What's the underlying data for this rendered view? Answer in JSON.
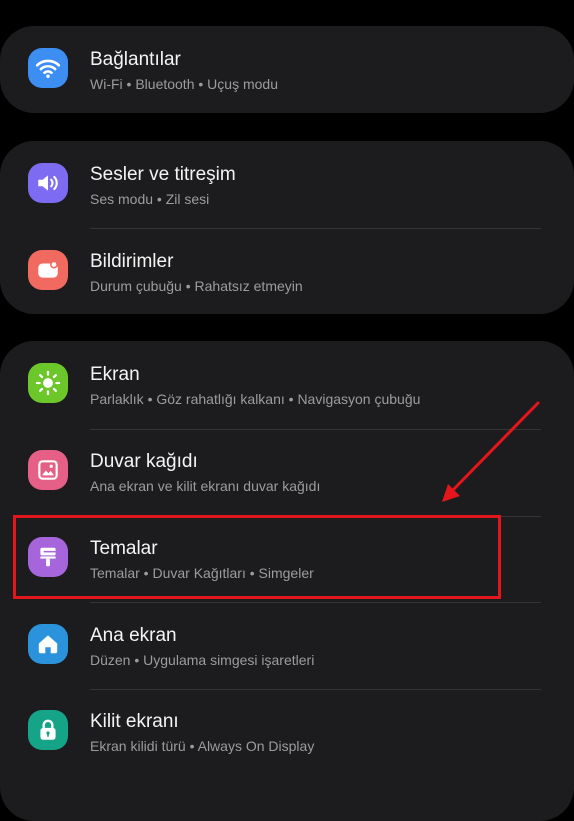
{
  "colors": {
    "background": "#000000",
    "card": "#1c1c1e",
    "highlight": "#e3161c"
  },
  "groups": [
    {
      "items": [
        {
          "title": "Bağlantılar",
          "subtitle": "Wi-Fi  •  Bluetooth  •  Uçuş modu",
          "icon": "wifi-icon",
          "icon_color": "#3d8ef3"
        }
      ]
    },
    {
      "items": [
        {
          "title": "Sesler ve titreşim",
          "subtitle": "Ses modu  •  Zil sesi",
          "icon": "sound-icon",
          "icon_color": "#7d6cf1"
        },
        {
          "title": "Bildirimler",
          "subtitle": "Durum çubuğu  •  Rahatsız etmeyin",
          "icon": "notification-icon",
          "icon_color": "#f06a5f"
        }
      ]
    },
    {
      "items": [
        {
          "title": "Ekran",
          "subtitle": "Parlaklık  •  Göz rahatlığı kalkanı  •  Navigasyon çubuğu",
          "icon": "sun-icon",
          "icon_color": "#6bc72a"
        },
        {
          "title": "Duvar kağıdı",
          "subtitle": "Ana ekran ve kilit ekranı duvar kağıdı",
          "icon": "image-icon",
          "icon_color": "#e55f86"
        },
        {
          "title": "Temalar",
          "subtitle": "Temalar  •  Duvar Kağıtları  •  Simgeler",
          "icon": "brush-icon",
          "icon_color": "#a765db"
        },
        {
          "title": "Ana ekran",
          "subtitle": "Düzen  •  Uygulama simgesi işaretleri",
          "icon": "home-icon",
          "icon_color": "#2b93dc"
        },
        {
          "title": "Kilit ekranı",
          "subtitle": "Ekran kilidi türü  •  Always On Display",
          "icon": "lock-icon",
          "icon_color": "#16a489"
        }
      ]
    }
  ]
}
